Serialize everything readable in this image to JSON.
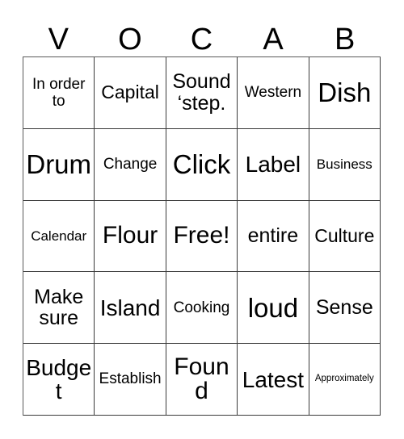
{
  "card": {
    "title": "VOCAB Bingo Card",
    "background_color": "#ffffff",
    "text_color": "#000000",
    "grid_line_color": "#3a3a3a",
    "header": {
      "letters": [
        "V",
        "O",
        "C",
        "A",
        "B"
      ]
    },
    "grid": {
      "columns": 5,
      "rows": 5,
      "free_space": "Free!",
      "cells": [
        [
          {
            "text": "In order to",
            "size": "fs-s"
          },
          {
            "text": "Capital",
            "size": "fs-m"
          },
          {
            "text": "Sound ‘step.",
            "size": "fs-ml"
          },
          {
            "text": "Western",
            "size": "fs-s"
          },
          {
            "text": "Dish",
            "size": "fs-xxl"
          }
        ],
        [
          {
            "text": "Drum",
            "size": "fs-xxl"
          },
          {
            "text": "Change",
            "size": "fs-s"
          },
          {
            "text": "Click",
            "size": "fs-xxl"
          },
          {
            "text": "Label",
            "size": "fs-l"
          },
          {
            "text": "Business",
            "size": "fs-xs"
          }
        ],
        [
          {
            "text": "Calendar",
            "size": "fs-xs"
          },
          {
            "text": "Flour",
            "size": "fs-xl"
          },
          {
            "text": "Free!",
            "size": "fs-xl"
          },
          {
            "text": "entire",
            "size": "fs-ml"
          },
          {
            "text": "Culture",
            "size": "fs-m"
          }
        ],
        [
          {
            "text": "Make sure",
            "size": "fs-ml"
          },
          {
            "text": "Island",
            "size": "fs-l"
          },
          {
            "text": "Cooking",
            "size": "fs-s"
          },
          {
            "text": "loud",
            "size": "fs-xxl"
          },
          {
            "text": "Sense",
            "size": "fs-ml"
          }
        ],
        [
          {
            "text": "Budget",
            "size": "fs-l"
          },
          {
            "text": "Establish",
            "size": "fs-s"
          },
          {
            "text": "Found",
            "size": "fs-xl"
          },
          {
            "text": "Latest",
            "size": "fs-l"
          },
          {
            "text": "Approximately",
            "size": "fs-xxs"
          }
        ]
      ]
    }
  }
}
